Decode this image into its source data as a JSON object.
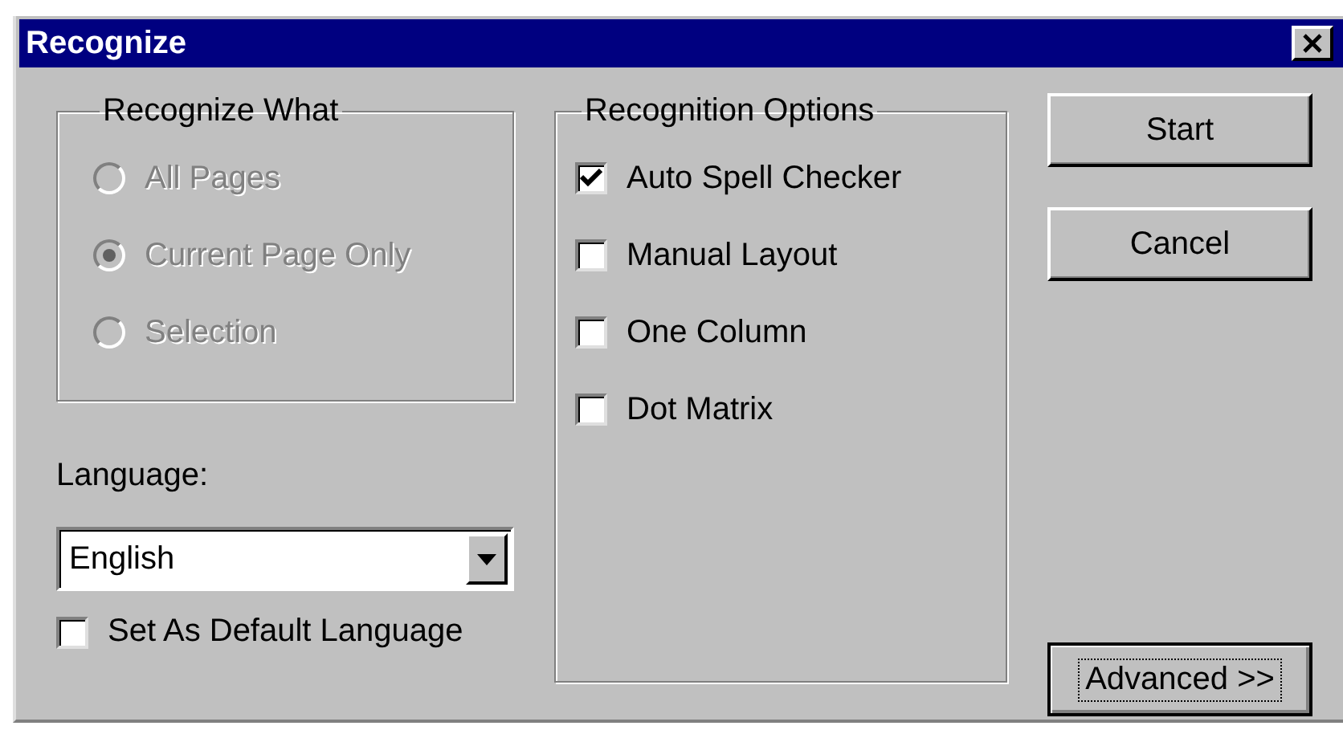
{
  "window": {
    "title": "Recognize"
  },
  "recognize_what": {
    "title": "Recognize What",
    "options": [
      {
        "label": "All Pages",
        "selected": false,
        "disabled": true
      },
      {
        "label": "Current Page Only",
        "selected": true,
        "disabled": true
      },
      {
        "label": "Selection",
        "selected": false,
        "disabled": true
      }
    ]
  },
  "language": {
    "label": "Language:",
    "value": "English"
  },
  "default_language": {
    "label": "Set As Default Language",
    "checked": false
  },
  "recognition_options": {
    "title": "Recognition Options",
    "items": [
      {
        "label": "Auto Spell Checker",
        "checked": true
      },
      {
        "label": "Manual Layout",
        "checked": false
      },
      {
        "label": "One Column",
        "checked": false
      },
      {
        "label": "Dot Matrix",
        "checked": false
      }
    ]
  },
  "buttons": [
    {
      "label": "Start",
      "focused": false
    },
    {
      "label": "Cancel",
      "focused": false
    },
    {
      "label": "Advanced >>",
      "focused": true
    }
  ]
}
